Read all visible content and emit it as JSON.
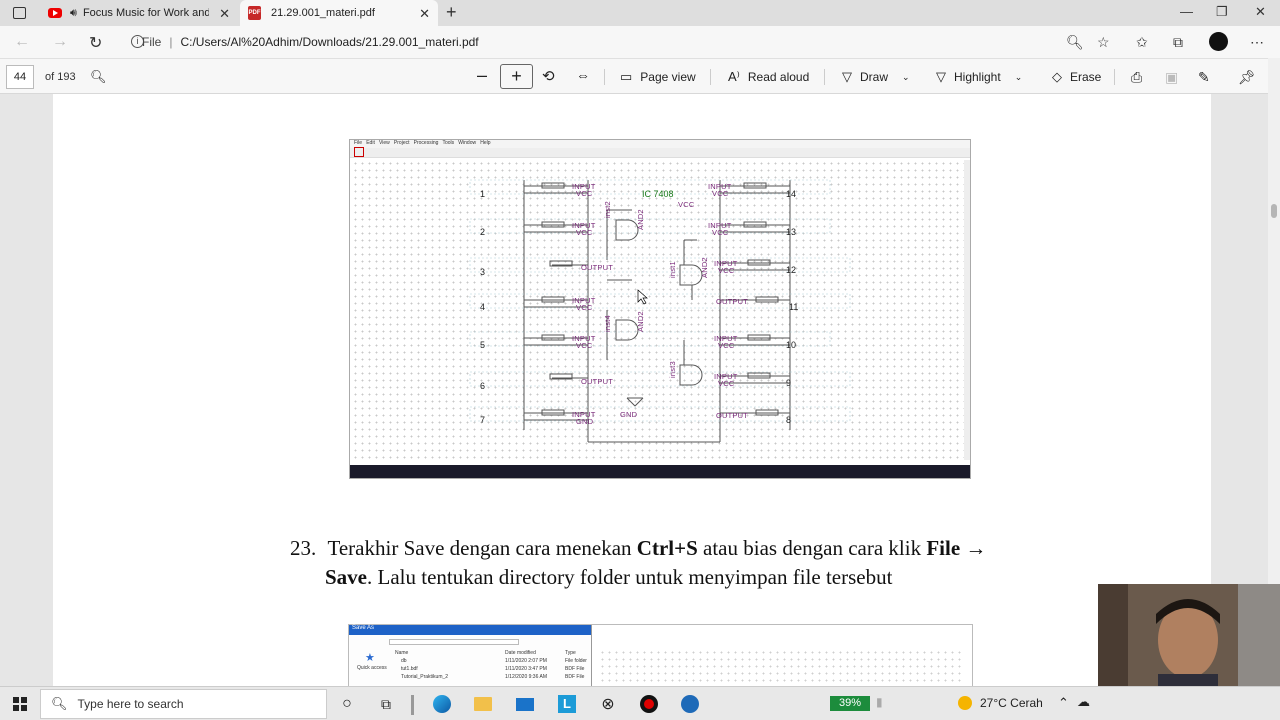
{
  "browser": {
    "tabs": [
      {
        "title": "Focus Music for Work and S",
        "active": false
      },
      {
        "title": "21.29.001_materi.pdf",
        "active": true
      }
    ],
    "new_tab_label": "+",
    "url_scheme": "File",
    "url": "C:/Users/Al%20Adhim/Downloads/21.29.001_materi.pdf"
  },
  "pdf_toolbar": {
    "page_number": "44",
    "page_count": "of 193",
    "page_view": "Page view",
    "read_aloud": "Read aloud",
    "draw": "Draw",
    "highlight": "Highlight",
    "erase": "Erase"
  },
  "schematic": {
    "ic_title": "IC 7408",
    "left_pins": [
      "1",
      "2",
      "3",
      "4",
      "5",
      "6",
      "7"
    ],
    "right_pins": [
      "14",
      "13",
      "12",
      "11",
      "10",
      "9",
      "8"
    ],
    "labels": {
      "input": "INPUT",
      "vcc": "VCC",
      "output": "OUTPUT",
      "gnd": "GND",
      "and2": "AND2",
      "inst1": "inst1",
      "inst2": "inst2",
      "inst3": "inst3",
      "inst4": "inst4"
    }
  },
  "document": {
    "step_number": "23.",
    "step_text_1": "Terakhir Save dengan cara menekan ",
    "step_bold_1": "Ctrl+S",
    "step_text_2": " atau bias dengan cara klik ",
    "step_bold_2": "File →",
    "step_bold_3": "Save",
    "step_text_3": ". Lalu tentukan directory folder untuk menyimpan file tersebut"
  },
  "saveas_dialog": {
    "title": "Save As",
    "col_name": "Name",
    "col_date": "Date modified",
    "col_type": "Type",
    "quick_access": "Quick access",
    "rows": [
      {
        "name": "db",
        "date": "1/11/2020 2:07 PM",
        "type": "File folder"
      },
      {
        "name": "tut1.bdf",
        "date": "1/11/2020 3:47 PM",
        "type": "BDF File"
      },
      {
        "name": "Tutorial_Praktikum_2",
        "date": "1/12/2020 9:36 AM",
        "type": "BDF File"
      }
    ]
  },
  "taskbar": {
    "search_placeholder": "Type here to search",
    "battery": "39%",
    "weather": "27°C Cerah"
  }
}
